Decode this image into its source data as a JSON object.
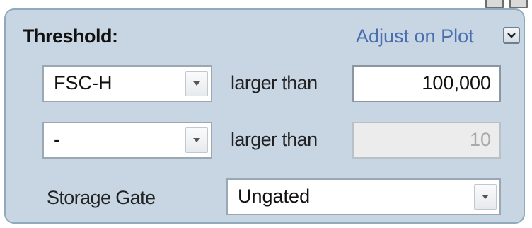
{
  "panel": {
    "title": "Threshold:",
    "adjust_link": "Adjust on Plot",
    "collapse_icon": "chevron-down-icon"
  },
  "rows": [
    {
      "parameter": "FSC-H",
      "comparison": "larger than",
      "value": "100,000",
      "enabled": true
    },
    {
      "parameter": "-",
      "comparison": "larger than",
      "value": "10",
      "enabled": false
    }
  ],
  "storage_gate": {
    "label": "Storage Gate",
    "value": "Ungated"
  },
  "dropdown_icon": "triangle-down-icon"
}
